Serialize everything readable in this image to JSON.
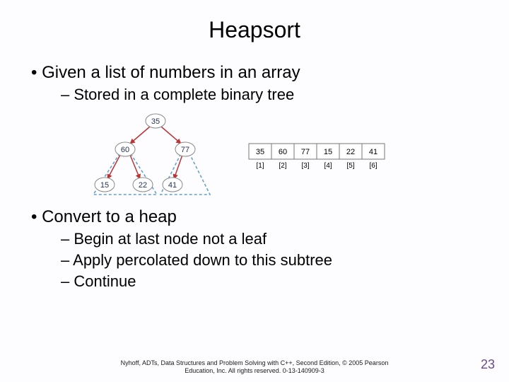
{
  "title": "Heapsort",
  "bullets": {
    "b1": "Given a list of numbers in an array",
    "s1": "Stored in a complete binary tree",
    "b2": "Convert to a heap",
    "s2": "Begin at last node not a leaf",
    "s3": "Apply percolated down to this subtree",
    "s4": "Continue"
  },
  "diagram": {
    "nodes": {
      "n1": "35",
      "n2": "60",
      "n3": "77",
      "n4": "15",
      "n5": "22",
      "n6": "41"
    },
    "array": {
      "values": [
        "35",
        "60",
        "77",
        "15",
        "22",
        "41"
      ],
      "indices": [
        "[1]",
        "[2]",
        "[3]",
        "[4]",
        "[5]",
        "[6]"
      ]
    }
  },
  "footer": {
    "line1": "Nyhoff, ADTs, Data Structures and Problem Solving with C++, Second Edition, © 2005 Pearson",
    "line2": "Education, Inc. All rights reserved. 0-13-140909-3"
  },
  "pagenum": "23"
}
